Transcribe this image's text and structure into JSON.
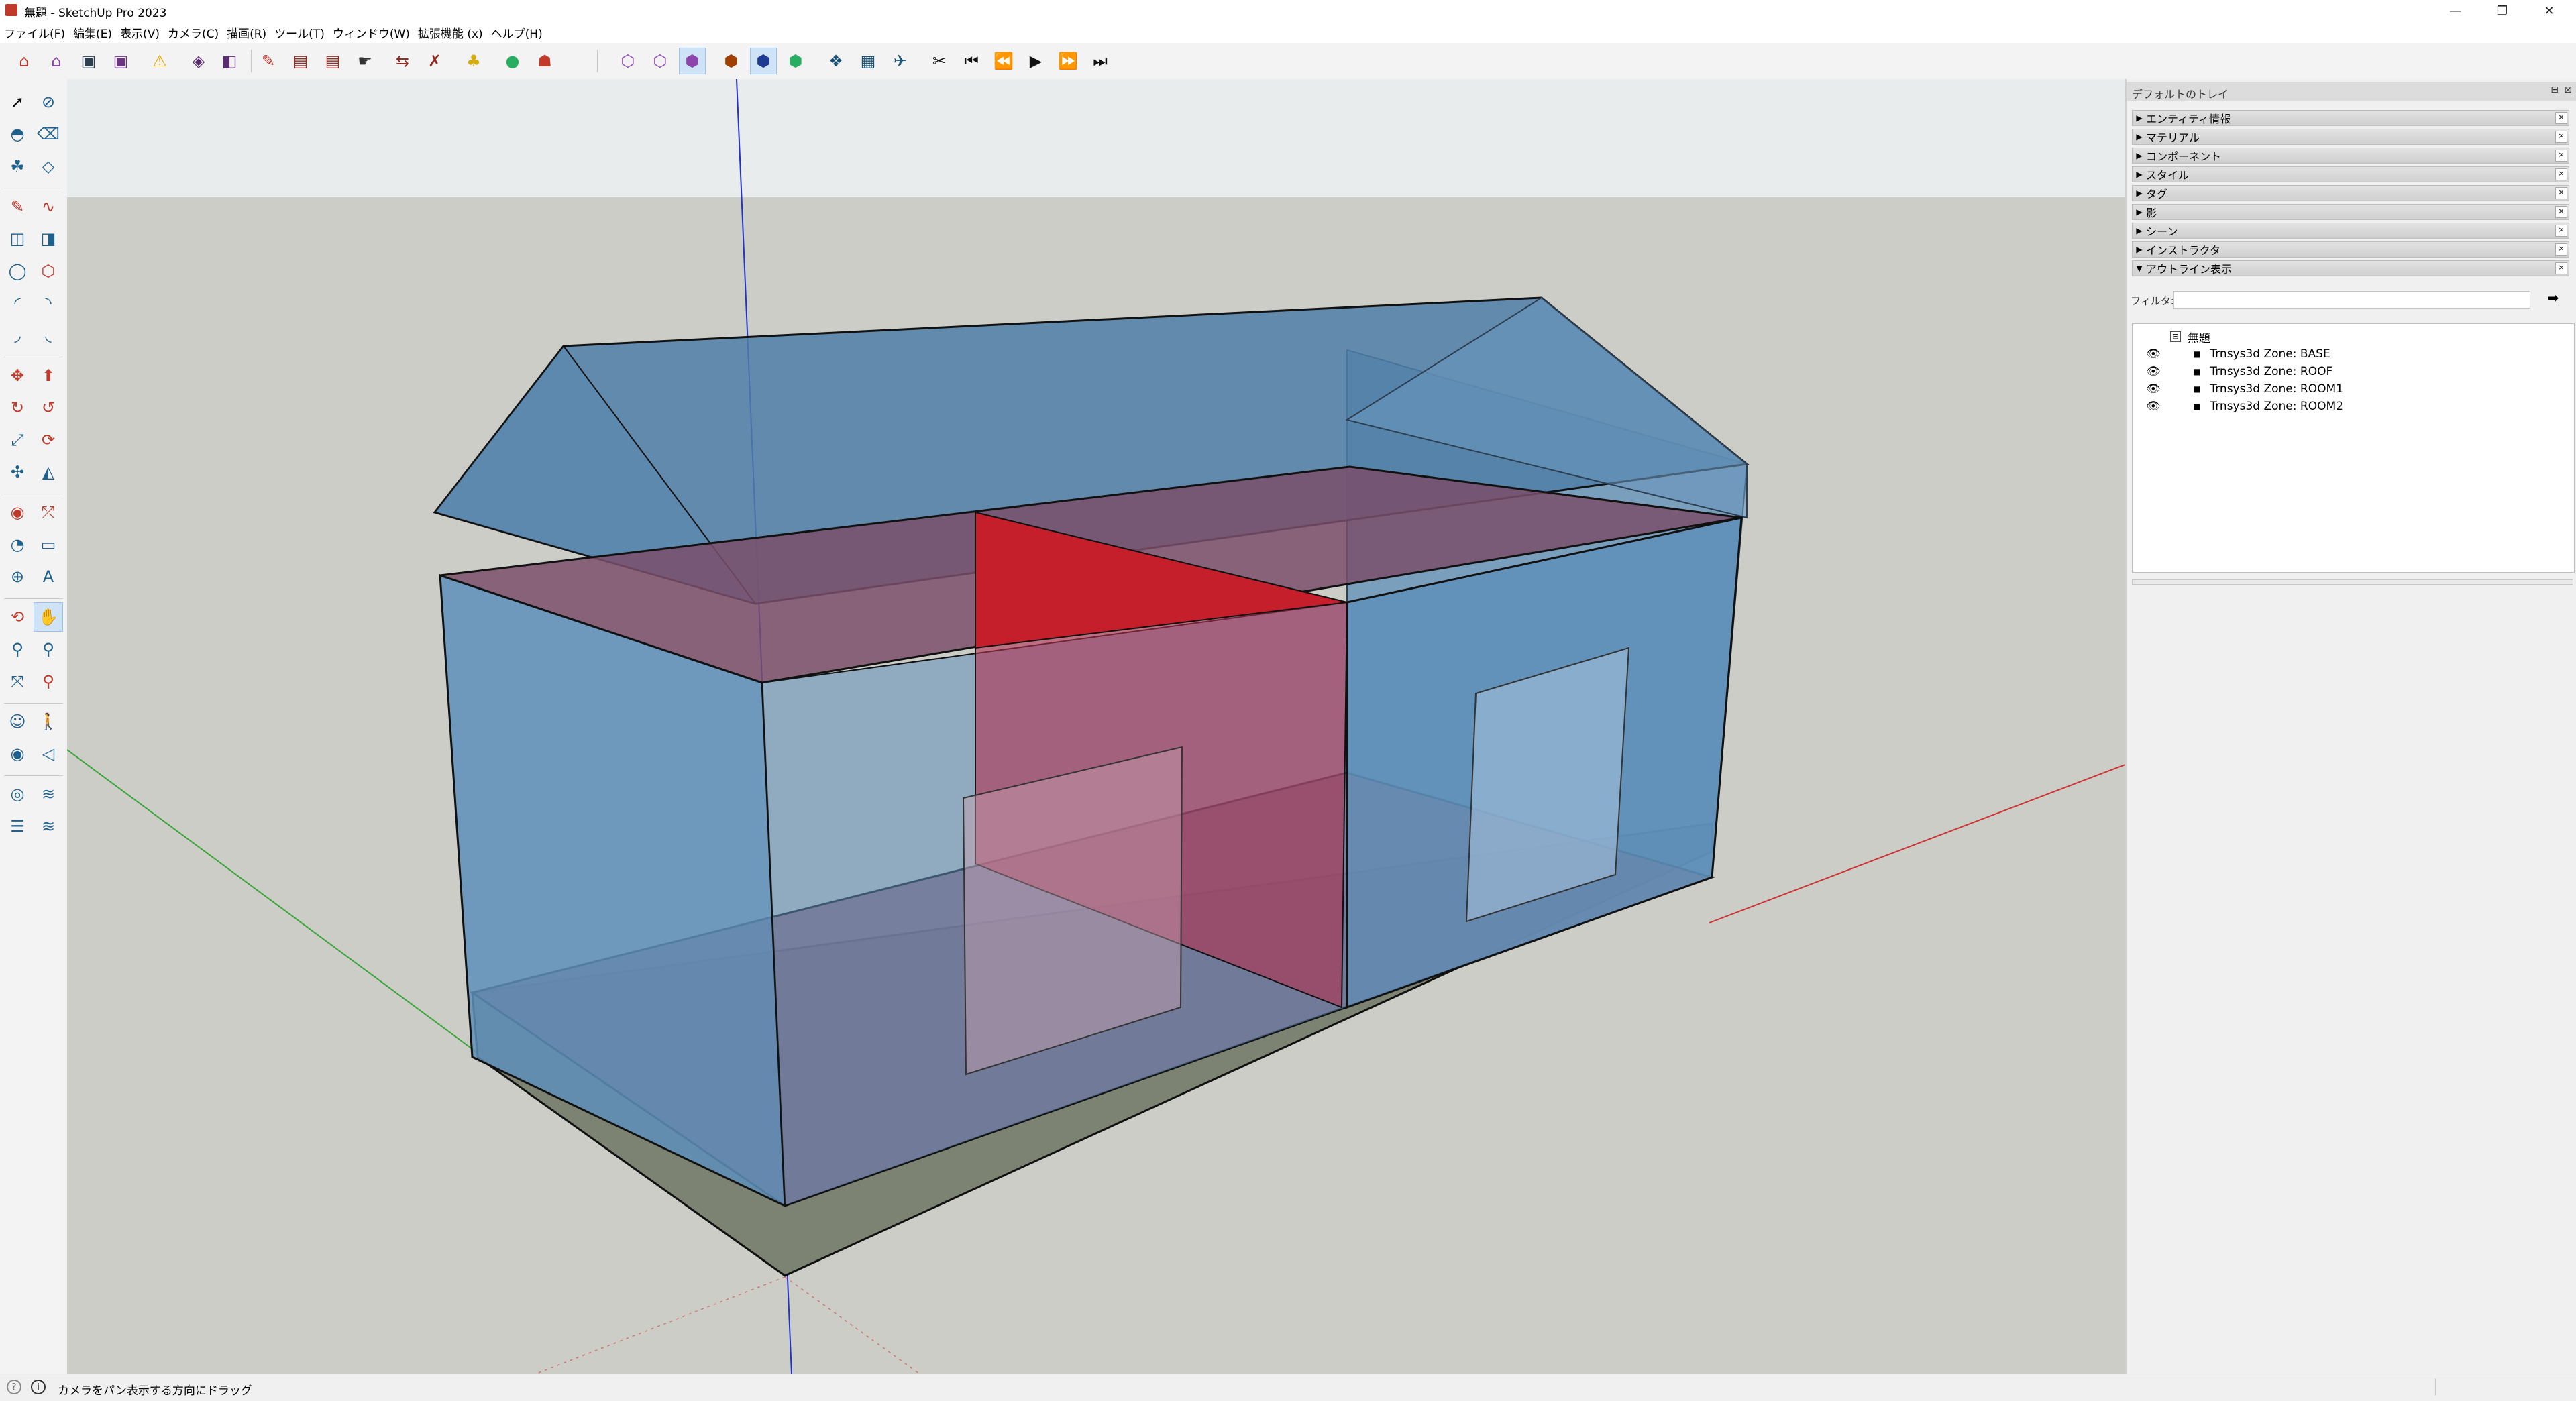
{
  "window": {
    "title": "無題 - SketchUp Pro 2023",
    "minimize": "—",
    "restore": "❐",
    "close": "✕"
  },
  "menu": [
    "ファイル(F)",
    "編集(E)",
    "表示(V)",
    "カメラ(C)",
    "描画(R)",
    "ツール(T)",
    "ウィンドウ(W)",
    "拡張機能 (x)",
    "ヘルプ(H)"
  ],
  "tray": {
    "title": "デフォルトのトレイ",
    "panels": [
      {
        "label": "エンティティ情報",
        "arrow": "▶"
      },
      {
        "label": "マテリアル",
        "arrow": "▶"
      },
      {
        "label": "コンポーネント",
        "arrow": "▶"
      },
      {
        "label": "スタイル",
        "arrow": "▶"
      },
      {
        "label": "タグ",
        "arrow": "▶"
      },
      {
        "label": "影",
        "arrow": "▶"
      },
      {
        "label": "シーン",
        "arrow": "▶"
      },
      {
        "label": "インストラクタ",
        "arrow": "▶"
      },
      {
        "label": "アウトライン表示",
        "arrow": "▼"
      }
    ],
    "panel_close": "×",
    "filter_label": "フィルタ:",
    "filter_value": "",
    "outliner": {
      "root": "無題",
      "items": [
        "Trnsys3d Zone:  BASE",
        "Trnsys3d Zone:  ROOF",
        "Trnsys3d Zone:  ROOM1",
        "Trnsys3d Zone:  ROOM2"
      ]
    }
  },
  "status": {
    "text": "カメラをパン表示する方向にドラッグ"
  },
  "colors": {
    "sky": "#e9ecec",
    "ground": "#cdcdc8",
    "wall": "#5e8fba",
    "partition": "#c41f2a",
    "floor": "#8b5a6e",
    "base": "#7c8372"
  }
}
